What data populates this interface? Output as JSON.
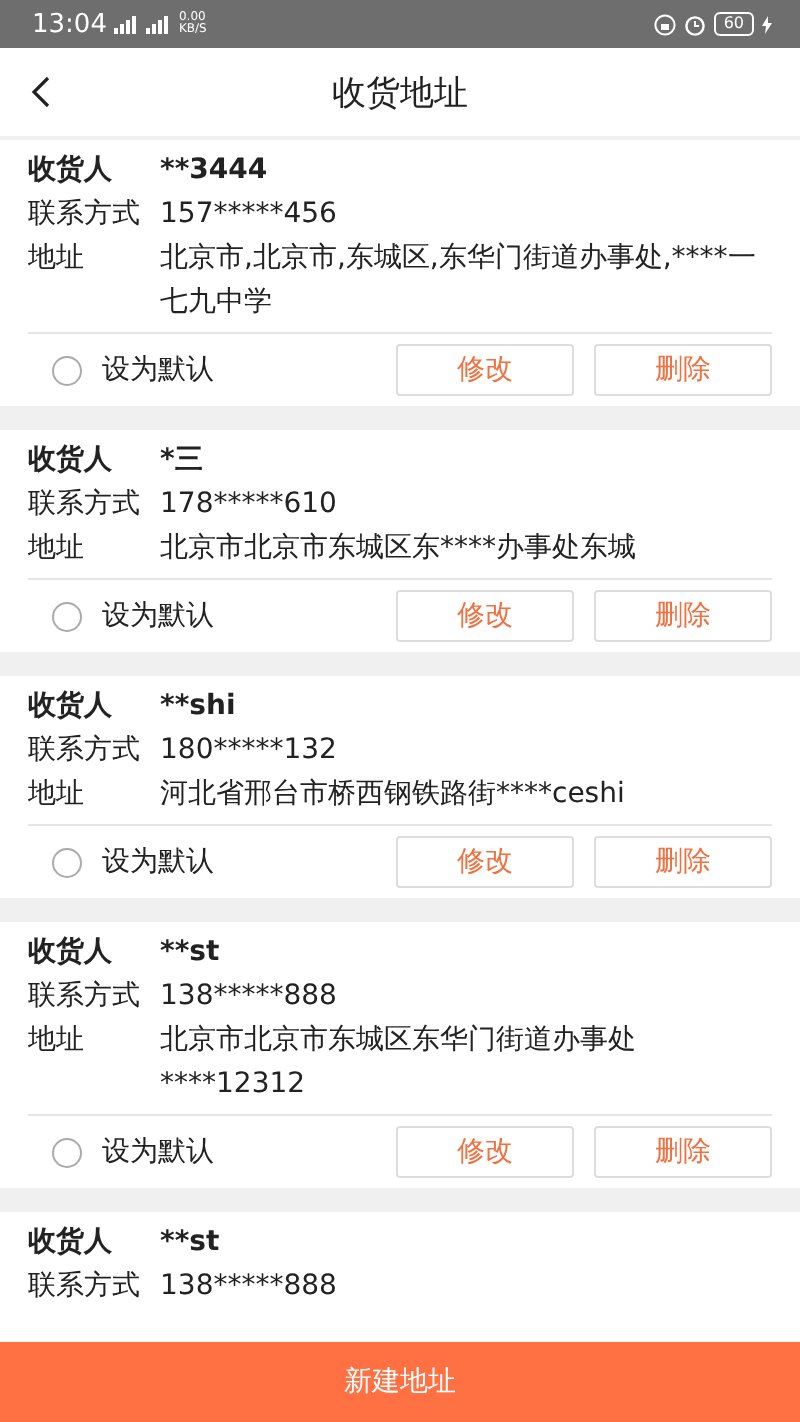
{
  "status_bar": {
    "time": "13:04",
    "net_speed": "0.00",
    "net_unit": "KB/S",
    "battery": "60"
  },
  "header": {
    "title": "收货地址"
  },
  "addresses": [
    {
      "name_label": "收货人",
      "name": "**3444",
      "phone_label": "联系方式",
      "phone": "157*****456",
      "address_label": "地址",
      "address": "北京市,北京市,东城区,东华门街道办事处,****一七九中学",
      "default_label": "设为默认",
      "is_default": false,
      "edit": "修改",
      "delete": "删除"
    },
    {
      "name_label": "收货人",
      "name": "*三",
      "phone_label": "联系方式",
      "phone": "178*****610",
      "address_label": "地址",
      "address": "北京市北京市东城区东****办事处东城",
      "default_label": "设为默认",
      "is_default": false,
      "edit": "修改",
      "delete": "删除"
    },
    {
      "name_label": "收货人",
      "name": "**shi",
      "phone_label": "联系方式",
      "phone": "180*****132",
      "address_label": "地址",
      "address": "河北省邢台市桥西钢铁路街****ceshi",
      "default_label": "设为默认",
      "is_default": false,
      "edit": "修改",
      "delete": "删除"
    },
    {
      "name_label": "收货人",
      "name": "**st",
      "phone_label": "联系方式",
      "phone": "138*****888",
      "address_label": "地址",
      "address": "北京市北京市东城区东华门街道办事处****12312",
      "default_label": "设为默认",
      "is_default": false,
      "edit": "修改",
      "delete": "删除"
    },
    {
      "name_label": "收货人",
      "name": "**st",
      "phone_label": "联系方式",
      "phone": "138*****888"
    }
  ],
  "new_button": "新建地址"
}
